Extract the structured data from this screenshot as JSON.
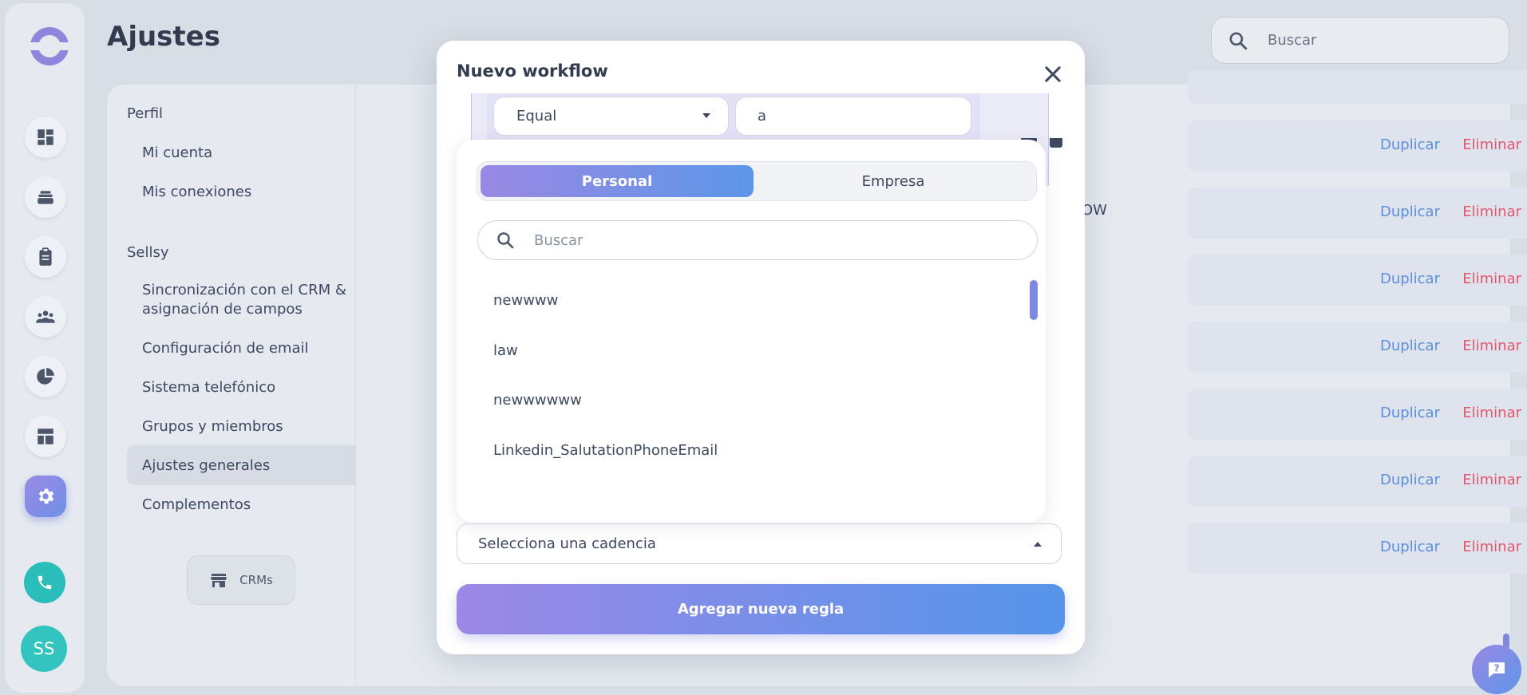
{
  "page": {
    "title": "Ajustes"
  },
  "search": {
    "placeholder": "Buscar"
  },
  "avatar": {
    "initials": "SS"
  },
  "sidebar": {
    "sections": [
      {
        "heading": "Perfil",
        "items": [
          "Mi cuenta",
          "Mis conexiones"
        ]
      },
      {
        "heading": "Sellsy",
        "items": [
          "Sincronización con el CRM & asignación de campos",
          "Configuración de email",
          "Sistema telefónico",
          "Grupos y miembros",
          "Ajustes generales",
          "Complementos"
        ]
      }
    ],
    "active_item": "Ajustes generales",
    "crms_button": "CRMs"
  },
  "workflows": {
    "duplicate_label": "Duplicar",
    "delete_label": "Eliminar",
    "partial_text": "OW",
    "rows": [
      {
        "enabled": false
      },
      {
        "enabled": false
      },
      {
        "enabled": true
      },
      {
        "enabled": true
      },
      {
        "enabled": true
      },
      {
        "enabled": false
      },
      {
        "enabled": true
      }
    ]
  },
  "modal": {
    "title": "Nuevo workflow",
    "condition": {
      "operator": "Equal",
      "value": "a"
    },
    "dropdown": {
      "tabs": [
        "Personal",
        "Empresa"
      ],
      "active_tab": "Personal",
      "search_placeholder": "Buscar",
      "options": [
        "newwww",
        "law",
        "newwwwww",
        "Linkedin_SalutationPhoneEmail"
      ]
    },
    "cadence_select": {
      "placeholder": "Selecciona una cadencia"
    },
    "add_rule_button": "Agregar nueva regla"
  },
  "colors": {
    "accent": "#7a76d8",
    "accent_blue": "#5c96e8",
    "link_blue": "#5b8fde",
    "danger": "#e2576b",
    "teal": "#2bbdb9"
  }
}
